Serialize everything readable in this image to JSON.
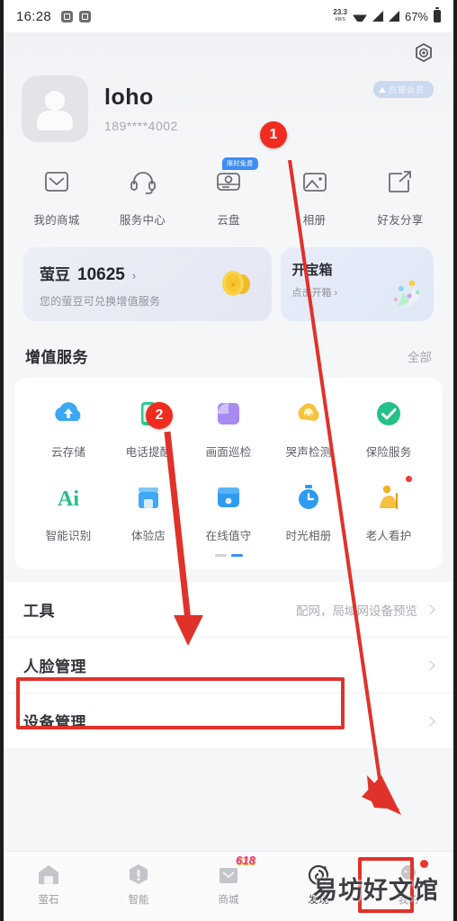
{
  "status_bar": {
    "time": "16:28",
    "net_speed": "23.3",
    "net_speed_unit": "KB/S",
    "battery": "67%",
    "icons": [
      "app-square-icon",
      "app-square-icon",
      "wifi-icon",
      "signal-icon",
      "signal-icon",
      "battery-icon"
    ]
  },
  "header": {
    "settings_icon": "gear-icon",
    "avatar": "default-avatar-icon",
    "user_name": "loho",
    "user_phone": "189****4002",
    "vip_badge": "白银会员"
  },
  "quick_actions": [
    {
      "label": "我的商城",
      "icon": "mail-box-icon"
    },
    {
      "label": "服务中心",
      "icon": "headset-icon"
    },
    {
      "label": "云盘",
      "icon": "cloud-disk-icon",
      "badge": "限时免费"
    },
    {
      "label": "相册",
      "icon": "photo-icon"
    },
    {
      "label": "好友分享",
      "icon": "share-external-icon"
    }
  ],
  "bean_card": {
    "title": "萤豆",
    "amount": "10625",
    "chevron": "›",
    "subtitle": "您的萤豆可兑换增值服务",
    "icon": "gold-coin-icon"
  },
  "box_card": {
    "title": "开宝箱",
    "subtitle": "点击开箱 ›",
    "icon": "treasure-burst-icon"
  },
  "services_section": {
    "title": "增值服务",
    "all_label": "全部",
    "items": [
      {
        "label": "云存储",
        "icon": "cloud-storage-icon",
        "color": "#38a6f0"
      },
      {
        "label": "电话提醒",
        "icon": "phone-alert-icon",
        "color": "#2ecc8f"
      },
      {
        "label": "画面巡检",
        "icon": "screen-patrol-icon",
        "color": "#a78bf0"
      },
      {
        "label": "哭声检测",
        "icon": "cry-detect-icon",
        "color": "#f5c43a"
      },
      {
        "label": "保险服务",
        "icon": "insurance-check-icon",
        "color": "#24c188"
      },
      {
        "label": "智能识别",
        "icon": "ai-recognition-icon",
        "color": "#22c08a"
      },
      {
        "label": "体验店",
        "icon": "store-icon",
        "color": "#3fa9f5"
      },
      {
        "label": "在线值守",
        "icon": "online-guard-icon",
        "color": "#2f9bf0"
      },
      {
        "label": "时光相册",
        "icon": "time-album-icon",
        "color": "#2f9bf0"
      },
      {
        "label": "老人看护",
        "icon": "elder-care-icon",
        "color": "#f2b01e",
        "badge_dot": true
      }
    ],
    "page_dots": 2,
    "active_page": 1
  },
  "list_rows": [
    {
      "label": "工具",
      "sub": "配网，局域网设备预览",
      "chevron": "›",
      "highlighted": true
    },
    {
      "label": "人脸管理",
      "sub": "",
      "chevron": "›",
      "highlighted": false
    },
    {
      "label": "设备管理",
      "sub": "",
      "chevron": "›",
      "highlighted": false
    }
  ],
  "tab_bar": [
    {
      "label": "萤石",
      "icon": "home-icon",
      "active": false
    },
    {
      "label": "智能",
      "icon": "smart-icon",
      "active": false
    },
    {
      "label": "商城",
      "icon": "mall-icon",
      "active": false,
      "badge": "618"
    },
    {
      "label": "发现",
      "icon": "discover-icon",
      "active": true
    },
    {
      "label": "我的",
      "icon": "profile-face-icon",
      "active": false,
      "dot": true,
      "highlighted": true
    }
  ],
  "annotations": {
    "marker_1": "1",
    "marker_2": "2",
    "watermark": "易坊好文馆",
    "accent_color": "#e0322b"
  }
}
